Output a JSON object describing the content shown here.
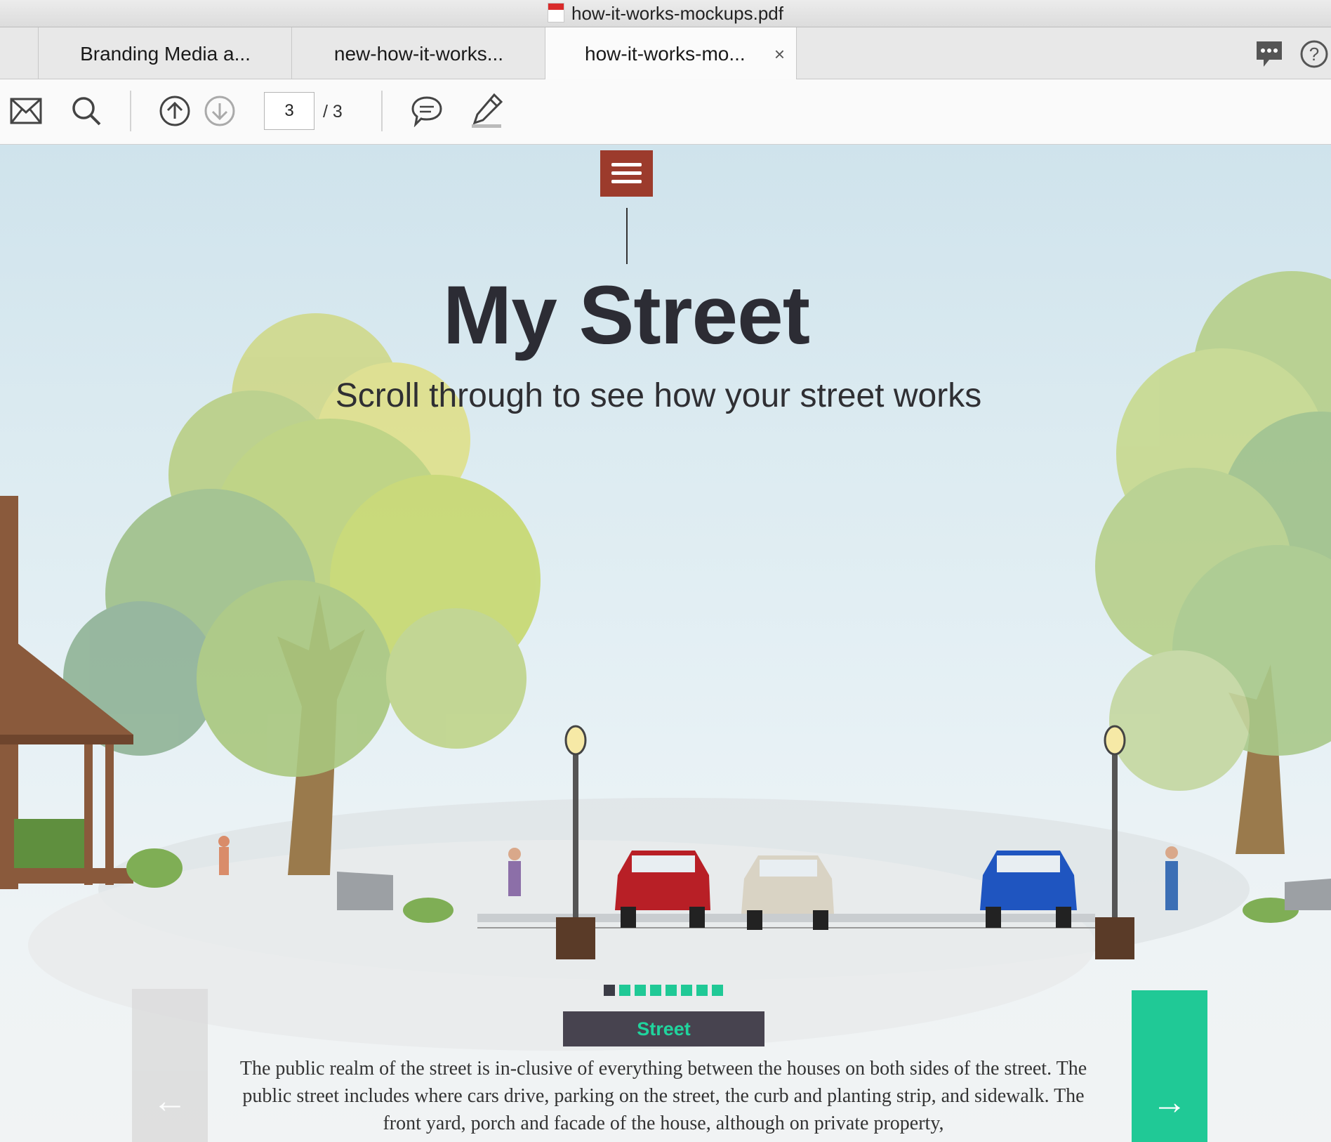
{
  "window": {
    "title": "how-it-works-mockups.pdf"
  },
  "tabs": [
    {
      "label": "Branding Media a..."
    },
    {
      "label": "new-how-it-works..."
    },
    {
      "label": "how-it-works-mo...",
      "close": "×"
    }
  ],
  "toolbar": {
    "page_current": "3",
    "page_total": "/ 3"
  },
  "icons": [
    "pdf-icon",
    "chat-bubble-icon",
    "help-icon",
    "mail-icon",
    "search-icon",
    "page-up-icon",
    "page-down-icon",
    "comment-icon",
    "highlight-pen-icon",
    "hamburger-menu-icon",
    "arrow-left-icon",
    "arrow-right-icon"
  ],
  "page": {
    "title": "My Street",
    "subtitle": "Scroll through to see how your street works",
    "section_label": "Street",
    "nav_prev": "←",
    "nav_next": "→",
    "description": "The public realm of the street is in-clusive of everything between the houses on both sides of the street. The public street includes where cars drive, parking on the street, the curb and planting strip, and sidewalk. The front yard, porch and facade of the house, although on private property,"
  },
  "colors": {
    "menu": "#9c3b2c",
    "accent": "#20c996",
    "label_bg": "#47434f",
    "title": "#2c2c34"
  }
}
